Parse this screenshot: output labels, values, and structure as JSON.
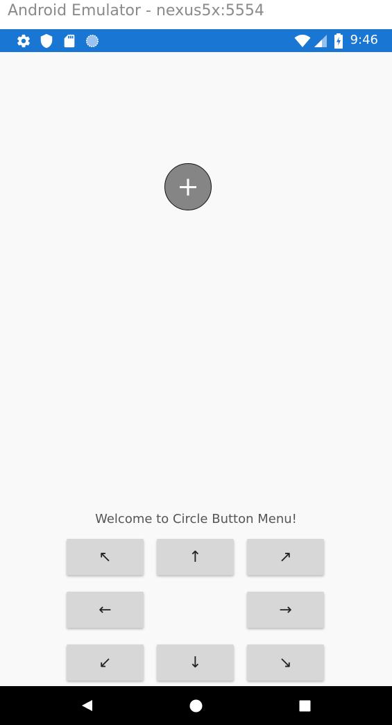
{
  "window": {
    "title": "Android Emulator - nexus5x:5554"
  },
  "status_bar": {
    "time": "9:46",
    "background": "#1976d2",
    "left_icons": [
      "settings-icon",
      "shield-icon",
      "sd-card-icon",
      "sync-icon"
    ],
    "right_icons": [
      "wifi-icon",
      "cell-signal-icon",
      "battery-icon"
    ]
  },
  "app": {
    "background": "#f8f9f8",
    "menu_button": {
      "icon": "plus-icon",
      "color": "#858585"
    },
    "welcome_text": "Welcome to Circle Button Menu!",
    "direction_buttons": {
      "up_left": "↖",
      "up": "↑",
      "up_right": "↗",
      "left": "←",
      "right": "→",
      "down_left": "↙",
      "down": "↓",
      "down_right": "↘"
    }
  },
  "nav_bar": {
    "items": [
      "back-icon",
      "home-icon",
      "recents-icon"
    ]
  }
}
